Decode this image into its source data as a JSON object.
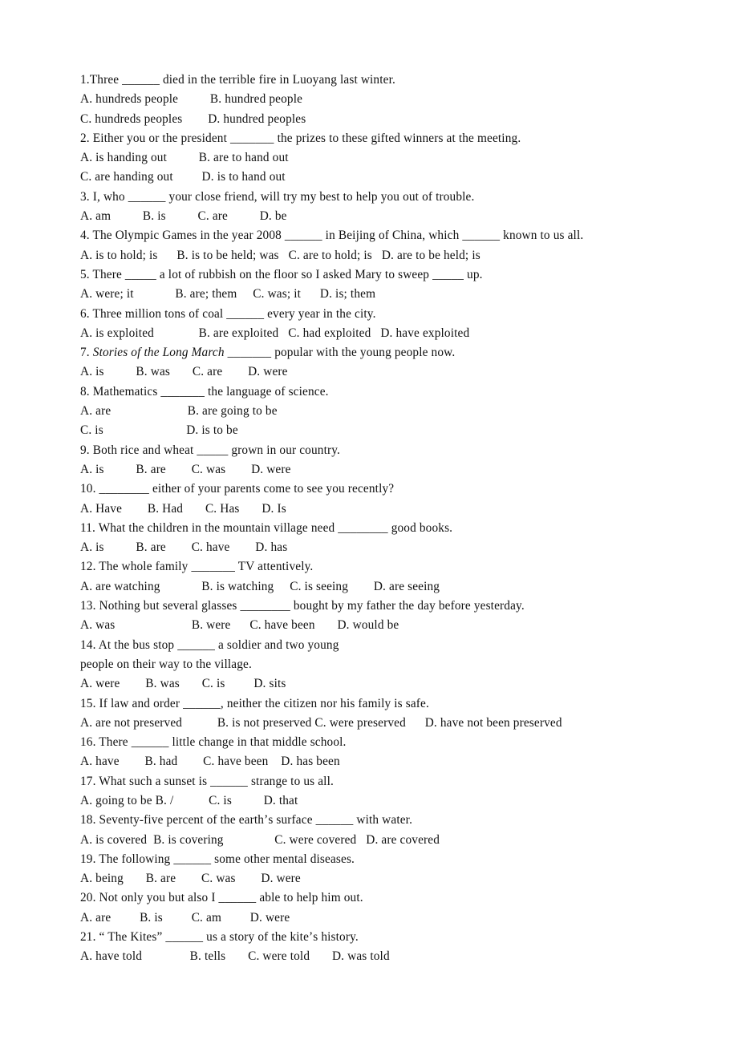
{
  "document": {
    "type": "grammar-worksheet",
    "background_color": "#ffffff",
    "text_color": "#111111",
    "questions": [
      {
        "number": "1",
        "stem": "1.Three ______ died in the terrible fire in Luoyang last winter.",
        "option_lines": [
          "A. hundreds people          B. hundred people",
          "C. hundreds peoples        D. hundred peoples"
        ]
      },
      {
        "number": "2",
        "stem": "2. Either you or the president _______ the prizes to these gifted winners at the meeting.",
        "option_lines": [
          "A. is handing out          B. are to hand out",
          "C. are handing out         D. is to hand out"
        ]
      },
      {
        "number": "3",
        "stem": "3. I, who ______ your close friend, will try my best to help you out of trouble.",
        "option_lines": [
          "A. am          B. is          C. are          D. be"
        ]
      },
      {
        "number": "4",
        "stem": "4. The Olympic Games in the year 2008 ______ in Beijing of China, which ______ known to us all.",
        "option_lines": [
          "A. is to hold; is      B. is to be held; was   C. are to hold; is   D. are to be held; is"
        ]
      },
      {
        "number": "5",
        "stem": "5. There _____ a lot of rubbish on the floor so I asked Mary to sweep _____ up.",
        "option_lines": [
          "A. were; it             B. are; them     C. was; it      D. is; them"
        ]
      },
      {
        "number": "6",
        "stem": "6. Three million tons of coal ______ every year in the city.",
        "option_lines": [
          "A. is exploited              B. are exploited   C. had exploited   D. have exploited"
        ]
      },
      {
        "number": "7",
        "stem_prefix": "7. ",
        "stem_italic": "Stories of the Long March",
        "stem_suffix": " _______ popular with the young people now.",
        "option_lines": [
          "A. is          B. was       C. are        D. were"
        ]
      },
      {
        "number": "8",
        "stem": "8. Mathematics _______ the language of science.",
        "option_lines": [
          "A. are                        B. are going to be",
          "C. is                          D. is to be"
        ]
      },
      {
        "number": "9",
        "stem": "9. Both rice and wheat _____ grown in our country.",
        "option_lines": [
          "A. is          B. are        C. was        D. were"
        ]
      },
      {
        "number": "10",
        "stem": "10. ________ either of your parents come to see you recently?",
        "option_lines": [
          "A. Have        B. Had       C. Has       D. Is"
        ]
      },
      {
        "number": "11",
        "stem": "11. What the children in the mountain village need ________ good books.",
        "option_lines": [
          "A. is          B. are        C. have        D. has"
        ]
      },
      {
        "number": "12",
        "stem": "12. The whole family _______ TV attentively.",
        "option_lines": [
          "A. are watching             B. is watching     C. is seeing        D. are seeing"
        ]
      },
      {
        "number": "13",
        "stem": "13. Nothing but several glasses ________ bought by my father the day before yesterday.",
        "option_lines": [
          "A. was                        B. were      C. have been       D. would be"
        ]
      },
      {
        "number": "14",
        "stem": "14. At the bus stop ______ a soldier and two young",
        "stem_continuation": "people on their way to the village.",
        "option_lines": [
          "A. were        B. was       C. is         D. sits"
        ]
      },
      {
        "number": "15",
        "stem": "15. If law and order ______, neither the citizen nor his family is safe.",
        "option_lines": [
          "A. are not preserved           B. is not preserved C. were preserved      D. have not been preserved"
        ]
      },
      {
        "number": "16",
        "stem": "16. There ______ little change in that middle school.",
        "option_lines": [
          "A. have        B. had        C. have been    D. has been"
        ]
      },
      {
        "number": "17",
        "stem": "17. What such a sunset is ______ strange to us all.",
        "option_lines": [
          "A. going to be B. /           C. is          D. that"
        ]
      },
      {
        "number": "18",
        "stem": "18. Seventy-five percent of the earthʼs surface ______ with water.",
        "option_lines": [
          "A. is covered  B. is covering                C. were covered   D. are covered"
        ]
      },
      {
        "number": "19",
        "stem": "19. The following ______ some other mental diseases.",
        "option_lines": [
          "A. being       B. are        C. was        D. were"
        ]
      },
      {
        "number": "20",
        "stem": "20. Not only you but also I ______ able to help him out.",
        "option_lines": [
          "A. are         B. is         C. am         D. were"
        ]
      },
      {
        "number": "21",
        "stem": "21. “ The Kites” ______ us a story of the kiteʼs history.",
        "option_lines": [
          "A. have told               B. tells       C. were told       D. was told"
        ]
      }
    ]
  }
}
